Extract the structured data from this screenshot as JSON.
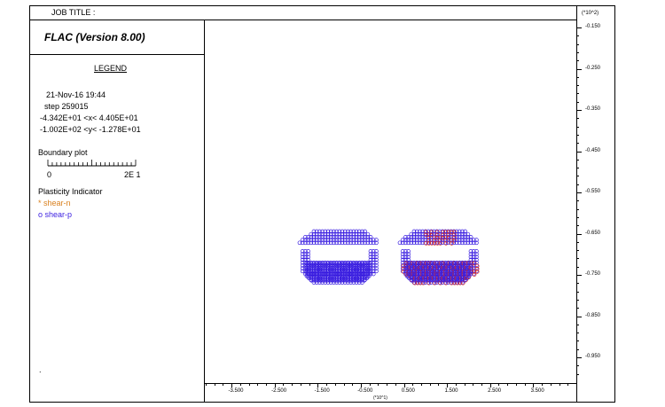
{
  "header": {
    "job_title_label": "JOB TITLE :",
    "program_title": "FLAC (Version 8.00)"
  },
  "legend": {
    "heading": "LEGEND",
    "date_time": "21-Nov-16  19:44",
    "step": "step   259015",
    "x_range": "-4.342E+01 <x<  4.405E+01",
    "y_range": "-1.002E+02 <y< -1.278E+01",
    "boundary_plot_label": "Boundary plot",
    "scale_left": "0",
    "scale_right": "2E  1",
    "plasticity_label": "Plasticity Indicator",
    "shear_n": "* shear-n",
    "shear_p": "o shear-p",
    "dot": "."
  },
  "axes": {
    "y_multiplier": "(*10^2)",
    "x_multiplier": "(*10^1)",
    "y_ticks": [
      "-0.150",
      "-0.250",
      "-0.350",
      "-0.450",
      "-0.550",
      "-0.650",
      "-0.750",
      "-0.850",
      "-0.950"
    ],
    "x_ticks": [
      "-3.500",
      "-2.500",
      "-1.500",
      "-0.500",
      "0.500",
      "1.500",
      "2.500",
      "3.500"
    ]
  },
  "colors": {
    "shear_n": "#e0301e",
    "shear_p": "#3a1ee0",
    "shear_n_text": "#d9801e",
    "shear_p_text": "#3a1ee0"
  }
}
